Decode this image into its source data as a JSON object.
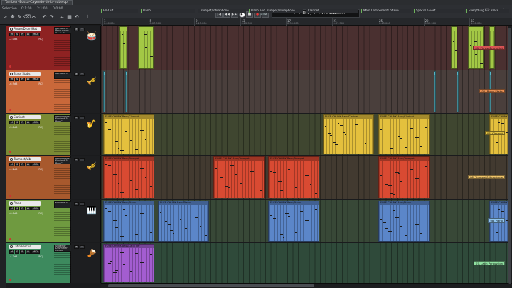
{
  "window": {
    "doc_tab": "Tambien-Bossa-Cayendo-de-la-nube.cpr"
  },
  "toolbar": {
    "selection_label": "Selection",
    "sel_start": "0:1:00",
    "sel_end": "2:1:00",
    "sel_len": "0:0:00",
    "position_label": "1:00",
    "position": "2.1.00 / 0:00.000",
    "state": "[Stopped]"
  },
  "markers": [
    {
      "label": "Fill-Out",
      "color": "#6fb35c"
    },
    {
      "label": "Piano",
      "color": "#6fb35c"
    },
    {
      "label": "Trumpet/Vibraphone",
      "color": "#6fb35c"
    },
    {
      "label": "Piano and Trumpet/Vibraphone",
      "color": "#6fb35c"
    },
    {
      "label": "Clarinet",
      "color": "#6fb35c"
    },
    {
      "label": "Main Components of Fun",
      "color": "#6fb35c"
    },
    {
      "label": "Special Guest",
      "color": "#6fb35c"
    },
    {
      "label": "Everything but Brass",
      "color": "#6fb35c"
    }
  ],
  "ruler": [
    "1",
    "5",
    "9",
    "13",
    "17",
    "21",
    "25",
    "29",
    "33",
    "37",
    "41"
  ],
  "ruler_sub": [
    "0:00.000",
    "0:07.500",
    "0:15.000",
    "0:22.500",
    "0:30.000",
    "0:37.500",
    "0:45.000",
    "0:52.500",
    "1:00.000",
    "1:07.500",
    "1:15.000"
  ],
  "tracks": [
    {
      "name": "PhraseDrum/Hat",
      "color": "#8e2222",
      "lane_color": "#4a3030",
      "inst_line1": "Kontakt 5",
      "inst_line2": "Percussion",
      "inst_line3": "Pan L/R",
      "vol": "-2.0dB",
      "pan": "(RC)",
      "tag": "01. PhraseDrum/Hat",
      "tag_color": "#d95454",
      "clip_color": "#a3c845",
      "clip_label": ""
    },
    {
      "name": "Brass Stabs",
      "color": "#c9683a",
      "lane_color": "#4a3f3c",
      "inst_line1": "Kontakt 5",
      "inst_line2": "",
      "inst_line3": "",
      "vol": "-6.9dB",
      "pan": "(RC)",
      "tag": "02. Brass Stabs",
      "tag_color": "#e88f52",
      "clip_color": "#57b7c7",
      "clip_label": ""
    },
    {
      "name": "Clarinet",
      "color": "#7a8a34",
      "lane_color": "#3f4630",
      "inst_line1": "Woodwinds",
      "inst_line2": "Kontakt 5",
      "inst_line3": "Pan C",
      "vol": "-3.8dB",
      "pan": "(RC)",
      "tag": "03. Clarinet",
      "tag_color": "#e6c542",
      "clip_color": "#e4c03d",
      "clip_label": "FUSE-CHUNK Bass/Clarinet"
    },
    {
      "name": "Trumpet/Vib",
      "color": "#a8592d",
      "lane_color": "#423a30",
      "inst_line1": "Woodwinds",
      "inst_line2": "Kontakt 5",
      "inst_line3": "Pan C",
      "vol": "-4.2dB",
      "pan": "(RC)",
      "tag": "06. Trumpet/Vibraphone",
      "tag_color": "#f0c56a",
      "clip_color": "#d94a32",
      "clip_label": "FUSE-CHUNK Bass/Trumpet"
    },
    {
      "name": "Piano",
      "color": "#6f9a40",
      "lane_color": "#384837",
      "inst_line1": "Kontakt 5",
      "inst_line2": "",
      "inst_line3": "",
      "vol": "-6.0dB",
      "pan": "(RC)",
      "tag": "08. Piano",
      "tag_color": "#8fc4ef",
      "clip_color": "#5b86c9",
      "clip_label": "FUSE-CHUNK Bass/Piano"
    },
    {
      "name": "Latin Percus",
      "color": "#3d8a5e",
      "lane_color": "#2f4a3a",
      "inst_line1": "Superior Drummer",
      "inst_line2": "Studio",
      "inst_line3": "",
      "vol": "-4.7dB",
      "pan": "(RC)",
      "tag": "07. Latin Percussion",
      "tag_color": "#8fe0a0",
      "clip_color": "#a35dd0",
      "clip_label": "FUSE-CHUNK Bass/Latin Per"
    }
  ]
}
